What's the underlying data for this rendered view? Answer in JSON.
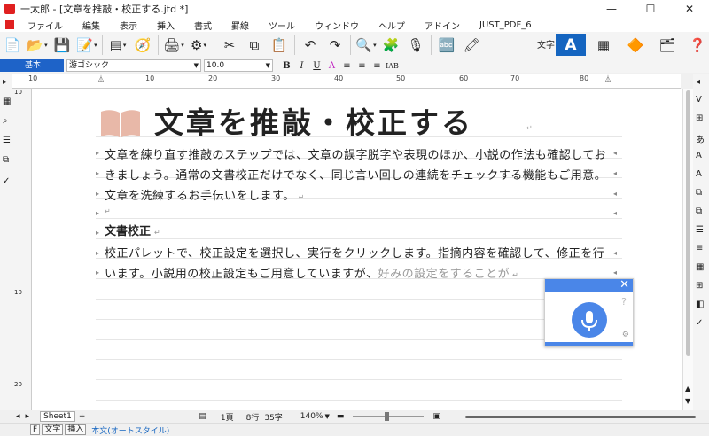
{
  "window": {
    "title": "一太郎 - [文章を推敲・校正する.jtd *]",
    "min": "—",
    "max": "☐",
    "close": "✕"
  },
  "menu": [
    "ファイル",
    "編集",
    "表示",
    "挿入",
    "書式",
    "罫線",
    "ツール",
    "ウィンドウ",
    "ヘルプ",
    "アドイン",
    "JUST_PDF_6"
  ],
  "toolbar": {
    "moji_label": "文字",
    "moji_button": "A"
  },
  "format": {
    "style": "基本",
    "font": "游ゴシック",
    "size": "10.0",
    "bold": "B",
    "italic": "I",
    "underline": "U",
    "font_color": "A",
    "tab": "IAB"
  },
  "ruler": {
    "ticks": [
      "10",
      "10",
      "20",
      "30",
      "40",
      "50",
      "60",
      "70",
      "80"
    ]
  },
  "vruler": {
    "ticks": [
      "10",
      "10",
      "20"
    ]
  },
  "doc": {
    "heading": "文章を推敲・校正する",
    "lines": [
      "文章を練り直す推敲のステップでは、文章の誤字脱字や表現のほか、小説の作法も確認してお",
      "きましょう。通常の文書校正だけでなく、同じ言い回しの連続をチェックする機能もご用意。",
      "文章を洗練するお手伝いをします。"
    ],
    "subheading": "文書校正",
    "sub_lines": [
      "校正パレットで、校正設定を選択し、実行をクリックします。指摘内容を確認して、修正を行"
    ],
    "last_line_main": "います。小説用の校正設定もご用意していますが、",
    "last_line_ghost": "好みの設定をすることが"
  },
  "voice": {
    "close": "✕",
    "help": "?",
    "gear": "⚙"
  },
  "status": {
    "sheet": "Sheet1",
    "page": "1頁",
    "line": "8行",
    "chars": "35字",
    "zoom": "140%"
  },
  "bottom": {
    "f": "F",
    "moji": "文字",
    "insert": "挿入",
    "style": "本文(オートスタイル)"
  },
  "colors": {
    "accent": "#1565c0",
    "voice": "#4a86e8"
  }
}
